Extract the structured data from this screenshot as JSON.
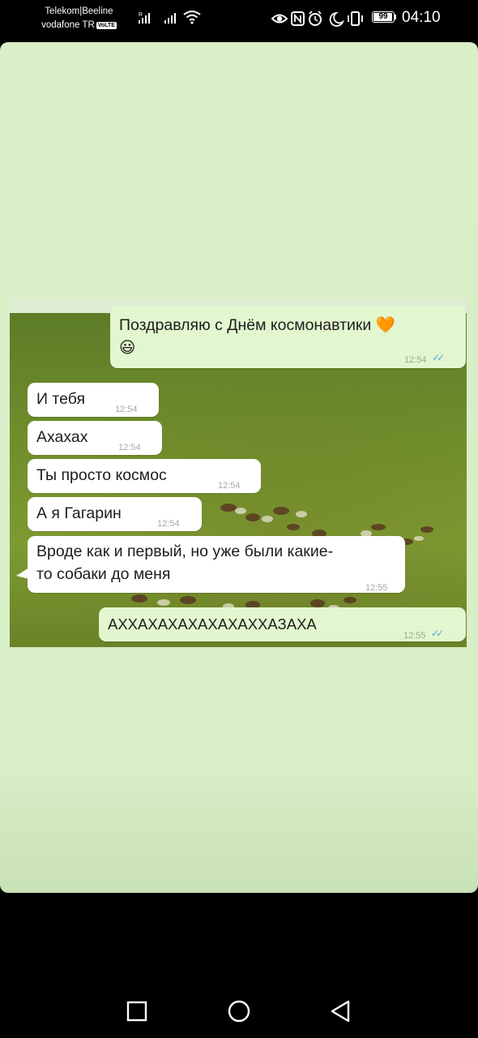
{
  "status_bar": {
    "carrier_1": "Telekom|Beeline",
    "carrier_2": "vodafone TR",
    "volte": "VoLTE",
    "roaming_mark": "R",
    "battery": "99",
    "time": "04:10",
    "icons": [
      "signal-icon",
      "signal-icon",
      "wifi-icon",
      "eye-icon",
      "nfc-icon",
      "alarm-icon",
      "moon-icon",
      "vibrate-icon",
      "battery-icon"
    ]
  },
  "chat": {
    "messages": [
      {
        "direction": "outgoing",
        "text_line_1": "Поздравляю с Днём космонавтики 🧡",
        "text_line_2": "😃",
        "time": "12:54",
        "ticks": "✓✓"
      },
      {
        "direction": "incoming",
        "text": "И тебя",
        "time": "12:54"
      },
      {
        "direction": "incoming",
        "text": "Ахахах",
        "time": "12:54"
      },
      {
        "direction": "incoming",
        "text": "Ты просто космос",
        "time": "12:54"
      },
      {
        "direction": "incoming",
        "text": "А я Гагарин",
        "time": "12:54"
      },
      {
        "direction": "incoming",
        "text_line_1": "Вроде как и первый, но уже были какие-",
        "text_line_2": "то собаки до меня",
        "time": "12:55"
      },
      {
        "direction": "outgoing",
        "text": "АХХАХАХАХАХАХАХХАЗАХА",
        "time": "12:55",
        "ticks": "✓✓"
      }
    ]
  },
  "nav_bar": {
    "icons": [
      "recent-apps-icon",
      "home-icon",
      "back-icon"
    ]
  },
  "colors": {
    "story_background": "#d9efc8",
    "outgoing_bubble": "#e2f6cf",
    "incoming_bubble": "#ffffff",
    "read_ticks": "#5ba9e0",
    "grass": "#6f8e2b"
  }
}
